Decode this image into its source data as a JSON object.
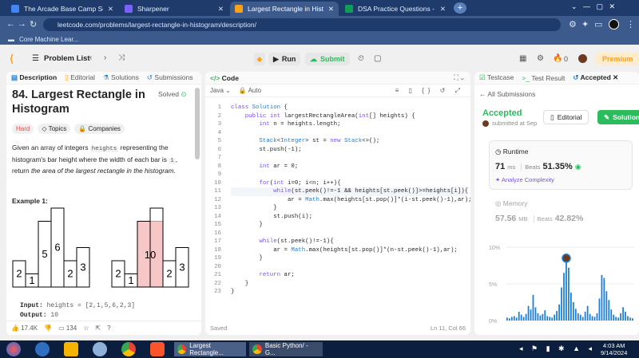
{
  "browser": {
    "tabs": [
      {
        "title": "The Arcade Base Camp Septemb",
        "color": "#4285f4"
      },
      {
        "title": "Sharpener",
        "color": "#7b61ff"
      },
      {
        "title": "Largest Rectangle in Histogram -",
        "color": "#ffa116"
      },
      {
        "title": "DSA Practice Questions - Google",
        "color": "#0f9d58"
      }
    ],
    "new_tab": "+",
    "url": "leetcode.com/problems/largest-rectangle-in-histogram/description/",
    "bookmark": "Core Machine Lear..."
  },
  "header": {
    "problem_list": "Problem List",
    "run": "Run",
    "submit": "Submit",
    "streak": "0",
    "premium": "Premium"
  },
  "description": {
    "tabs": [
      "Description",
      "Editorial",
      "Solutions",
      "Submissions"
    ],
    "title": "84. Largest Rectangle in Histogram",
    "solved": "Solved",
    "difficulty": "Hard",
    "topics": "Topics",
    "companies": "Companies",
    "text_1": "Given an array of integers",
    "text_code": "heights",
    "text_2": "representing the histogram's bar height where the width of each bar is",
    "text_one": "1",
    "text_3": ", return",
    "text_em": "the area of the largest rectangle in the histogram",
    "text_end": ".",
    "example_title": "Example 1:",
    "bars": [
      2,
      1,
      5,
      6,
      2,
      3
    ],
    "rect_label": "10",
    "input_label": "Input:",
    "input_value": "heights = [2,1,5,6,2,3]",
    "output_label": "Output:",
    "output_value": "10",
    "likes": "17.4K",
    "comments": "134"
  },
  "code_panel": {
    "title": "Code",
    "language": "Java",
    "auto": "Auto",
    "saved": "Saved",
    "cursor": "Ln 11, Col 66",
    "lines": [
      "class Solution {",
      "    public int largestRectangleArea(int[] heights) {",
      "        int n = heights.length;",
      "",
      "        Stack<Integer> st = new Stack<>();",
      "        st.push(-1);",
      "",
      "        int ar = 0;",
      "",
      "        for(int i=0; i<n; i++){",
      "            while(st.peek()!=-1 && heights[st.peek()]>=heights[i]){",
      "                ar = Math.max(heights[st.pop()]*(i-st.peek()-1),ar);",
      "            }",
      "            st.push(i);",
      "        }",
      "",
      "        while(st.peek()!=-1){",
      "            ar = Math.max(heights[st.pop()]*(n-st.peek()-1),ar);",
      "        }",
      "",
      "        return ar;",
      "    }",
      "}"
    ]
  },
  "result_panel": {
    "tabs": [
      "Testcase",
      "Test Result",
      "Accepted"
    ],
    "all_submissions": "All Submissions",
    "status": "Accepted",
    "submitted": "submitted at Sep",
    "editorial": "Editorial",
    "solution": "Solution",
    "runtime_label": "Runtime",
    "runtime_value": "71",
    "runtime_unit": "ms",
    "beats_label": "Beats",
    "runtime_beats": "51.35%",
    "analyze": "Analyze Complexity",
    "memory_label": "Memory",
    "memory_value": "57.56",
    "memory_unit": "MB",
    "memory_beats": "42.82%",
    "y_ticks": [
      "10%",
      "5%",
      "0%"
    ]
  },
  "chart_data": {
    "type": "bar",
    "title": "",
    "xlabel": "",
    "ylabel": "",
    "ylim": [
      0,
      10
    ],
    "values": [
      0.4,
      0.3,
      0.5,
      0.6,
      0.4,
      1.2,
      0.8,
      0.5,
      0.9,
      2.0,
      1.5,
      3.5,
      1.8,
      1.0,
      0.7,
      0.9,
      1.4,
      0.6,
      0.5,
      0.4,
      0.8,
      1.3,
      2.2,
      4.5,
      6.5,
      8.5,
      7.2,
      3.8,
      2.5,
      1.6,
      1.0,
      0.8,
      0.5,
      1.2,
      2.0,
      0.9,
      0.6,
      0.5,
      1.0,
      3.0,
      6.2,
      5.8,
      4.0,
      2.8,
      1.5,
      0.8,
      0.5,
      0.4,
      1.0,
      1.8,
      1.2,
      0.6,
      0.4,
      0.3
    ],
    "highlight_index": 25,
    "grid": true
  },
  "taskbar": {
    "tasks": [
      "Largest Rectangle...",
      "Basic Python/ - G..."
    ],
    "time": "4:03 AM",
    "date": "9/14/2024"
  }
}
